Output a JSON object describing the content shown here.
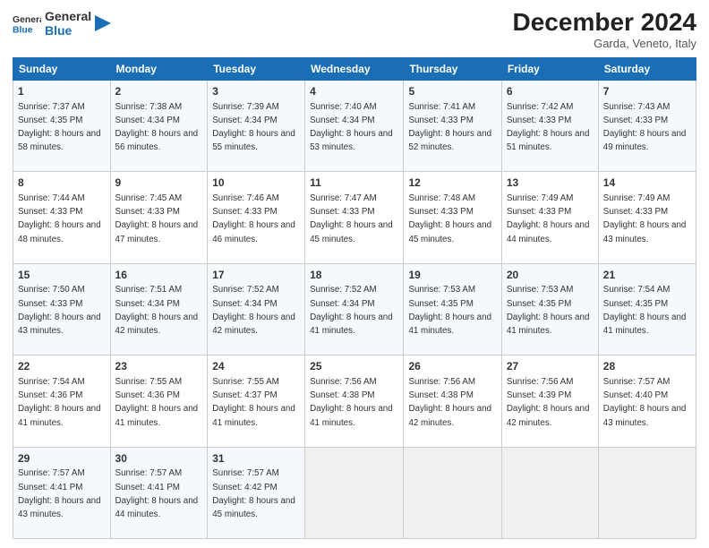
{
  "logo": {
    "line1": "General",
    "line2": "Blue"
  },
  "title": "December 2024",
  "location": "Garda, Veneto, Italy",
  "days_of_week": [
    "Sunday",
    "Monday",
    "Tuesday",
    "Wednesday",
    "Thursday",
    "Friday",
    "Saturday"
  ],
  "weeks": [
    [
      {
        "day": "1",
        "sunrise": "Sunrise: 7:37 AM",
        "sunset": "Sunset: 4:35 PM",
        "daylight": "Daylight: 8 hours and 58 minutes."
      },
      {
        "day": "2",
        "sunrise": "Sunrise: 7:38 AM",
        "sunset": "Sunset: 4:34 PM",
        "daylight": "Daylight: 8 hours and 56 minutes."
      },
      {
        "day": "3",
        "sunrise": "Sunrise: 7:39 AM",
        "sunset": "Sunset: 4:34 PM",
        "daylight": "Daylight: 8 hours and 55 minutes."
      },
      {
        "day": "4",
        "sunrise": "Sunrise: 7:40 AM",
        "sunset": "Sunset: 4:34 PM",
        "daylight": "Daylight: 8 hours and 53 minutes."
      },
      {
        "day": "5",
        "sunrise": "Sunrise: 7:41 AM",
        "sunset": "Sunset: 4:33 PM",
        "daylight": "Daylight: 8 hours and 52 minutes."
      },
      {
        "day": "6",
        "sunrise": "Sunrise: 7:42 AM",
        "sunset": "Sunset: 4:33 PM",
        "daylight": "Daylight: 8 hours and 51 minutes."
      },
      {
        "day": "7",
        "sunrise": "Sunrise: 7:43 AM",
        "sunset": "Sunset: 4:33 PM",
        "daylight": "Daylight: 8 hours and 49 minutes."
      }
    ],
    [
      {
        "day": "8",
        "sunrise": "Sunrise: 7:44 AM",
        "sunset": "Sunset: 4:33 PM",
        "daylight": "Daylight: 8 hours and 48 minutes."
      },
      {
        "day": "9",
        "sunrise": "Sunrise: 7:45 AM",
        "sunset": "Sunset: 4:33 PM",
        "daylight": "Daylight: 8 hours and 47 minutes."
      },
      {
        "day": "10",
        "sunrise": "Sunrise: 7:46 AM",
        "sunset": "Sunset: 4:33 PM",
        "daylight": "Daylight: 8 hours and 46 minutes."
      },
      {
        "day": "11",
        "sunrise": "Sunrise: 7:47 AM",
        "sunset": "Sunset: 4:33 PM",
        "daylight": "Daylight: 8 hours and 45 minutes."
      },
      {
        "day": "12",
        "sunrise": "Sunrise: 7:48 AM",
        "sunset": "Sunset: 4:33 PM",
        "daylight": "Daylight: 8 hours and 45 minutes."
      },
      {
        "day": "13",
        "sunrise": "Sunrise: 7:49 AM",
        "sunset": "Sunset: 4:33 PM",
        "daylight": "Daylight: 8 hours and 44 minutes."
      },
      {
        "day": "14",
        "sunrise": "Sunrise: 7:49 AM",
        "sunset": "Sunset: 4:33 PM",
        "daylight": "Daylight: 8 hours and 43 minutes."
      }
    ],
    [
      {
        "day": "15",
        "sunrise": "Sunrise: 7:50 AM",
        "sunset": "Sunset: 4:33 PM",
        "daylight": "Daylight: 8 hours and 43 minutes."
      },
      {
        "day": "16",
        "sunrise": "Sunrise: 7:51 AM",
        "sunset": "Sunset: 4:34 PM",
        "daylight": "Daylight: 8 hours and 42 minutes."
      },
      {
        "day": "17",
        "sunrise": "Sunrise: 7:52 AM",
        "sunset": "Sunset: 4:34 PM",
        "daylight": "Daylight: 8 hours and 42 minutes."
      },
      {
        "day": "18",
        "sunrise": "Sunrise: 7:52 AM",
        "sunset": "Sunset: 4:34 PM",
        "daylight": "Daylight: 8 hours and 41 minutes."
      },
      {
        "day": "19",
        "sunrise": "Sunrise: 7:53 AM",
        "sunset": "Sunset: 4:35 PM",
        "daylight": "Daylight: 8 hours and 41 minutes."
      },
      {
        "day": "20",
        "sunrise": "Sunrise: 7:53 AM",
        "sunset": "Sunset: 4:35 PM",
        "daylight": "Daylight: 8 hours and 41 minutes."
      },
      {
        "day": "21",
        "sunrise": "Sunrise: 7:54 AM",
        "sunset": "Sunset: 4:35 PM",
        "daylight": "Daylight: 8 hours and 41 minutes."
      }
    ],
    [
      {
        "day": "22",
        "sunrise": "Sunrise: 7:54 AM",
        "sunset": "Sunset: 4:36 PM",
        "daylight": "Daylight: 8 hours and 41 minutes."
      },
      {
        "day": "23",
        "sunrise": "Sunrise: 7:55 AM",
        "sunset": "Sunset: 4:36 PM",
        "daylight": "Daylight: 8 hours and 41 minutes."
      },
      {
        "day": "24",
        "sunrise": "Sunrise: 7:55 AM",
        "sunset": "Sunset: 4:37 PM",
        "daylight": "Daylight: 8 hours and 41 minutes."
      },
      {
        "day": "25",
        "sunrise": "Sunrise: 7:56 AM",
        "sunset": "Sunset: 4:38 PM",
        "daylight": "Daylight: 8 hours and 41 minutes."
      },
      {
        "day": "26",
        "sunrise": "Sunrise: 7:56 AM",
        "sunset": "Sunset: 4:38 PM",
        "daylight": "Daylight: 8 hours and 42 minutes."
      },
      {
        "day": "27",
        "sunrise": "Sunrise: 7:56 AM",
        "sunset": "Sunset: 4:39 PM",
        "daylight": "Daylight: 8 hours and 42 minutes."
      },
      {
        "day": "28",
        "sunrise": "Sunrise: 7:57 AM",
        "sunset": "Sunset: 4:40 PM",
        "daylight": "Daylight: 8 hours and 43 minutes."
      }
    ],
    [
      {
        "day": "29",
        "sunrise": "Sunrise: 7:57 AM",
        "sunset": "Sunset: 4:41 PM",
        "daylight": "Daylight: 8 hours and 43 minutes."
      },
      {
        "day": "30",
        "sunrise": "Sunrise: 7:57 AM",
        "sunset": "Sunset: 4:41 PM",
        "daylight": "Daylight: 8 hours and 44 minutes."
      },
      {
        "day": "31",
        "sunrise": "Sunrise: 7:57 AM",
        "sunset": "Sunset: 4:42 PM",
        "daylight": "Daylight: 8 hours and 45 minutes."
      },
      null,
      null,
      null,
      null
    ]
  ]
}
